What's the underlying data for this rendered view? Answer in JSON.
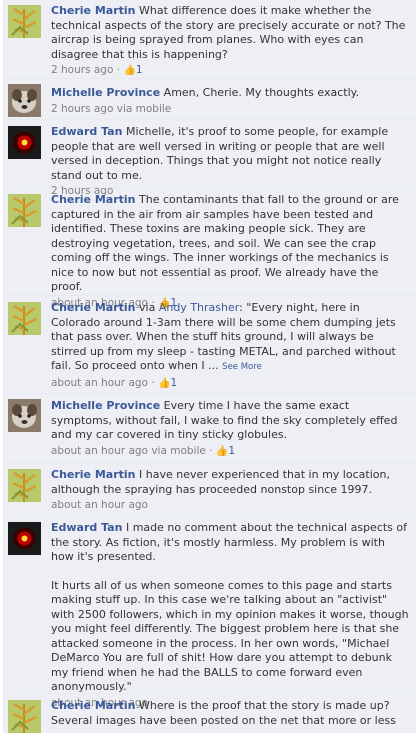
{
  "comments": [
    {
      "author": "Cherie Martin",
      "text": "What difference does it make whether the technical aspects of the story are precisely accurate or not? The aircrap is being sprayed from planes. Who with eyes can disagree that this is happening?",
      "time": "2 hours ago",
      "likes": "1"
    },
    {
      "author": "Michelle Province",
      "text": "Amen, Cherie. My thoughts exactly.",
      "time": "2 hours ago",
      "via": "via mobile"
    },
    {
      "author": "Edward Tan",
      "text": "Michelle, it's proof to some people, for example people that are well versed in writing or people that are well versed in deception. Things that you might not notice really stand out to me.",
      "time": "2 hours ago"
    },
    {
      "author": "Cherie Martin",
      "text": "The contaminants that fall to the ground or are captured in the air from air samples have been tested and identified. These toxins are making people sick. They are destroying vegetation, trees, and soil. We can see the crap coming off the wings. The inner workings of the mechanics is nice to now but not essential as proof. We already have the proof.",
      "time": "about an hour ago",
      "likes": "1"
    },
    {
      "author": "Cherie Martin",
      "via_prefix": "via",
      "via_name": "Andy Thrasher",
      "text": ": \"Every night, here in Colorado around 1-3am there will be some chem dumping jets that pass over. When the stuff hits ground, I will always be stirred up from my sleep - tasting METAL, and parched without fail. So proceed onto when I ...",
      "see_more": "See More",
      "time": "about an hour ago",
      "likes": "1"
    },
    {
      "author": "Michelle Province",
      "text": "Every time I have the same exact symptoms, without fail, I wake to find the sky completely effed and my car covered in tiny sticky globules.",
      "time": "about an hour ago",
      "via": "via mobile",
      "likes": "1"
    },
    {
      "author": "Cherie Martin",
      "text": "I have never experienced that in my location, although the spraying has proceeded nonstop since 1997.",
      "time": "about an hour ago"
    },
    {
      "author": "Edward Tan",
      "text": "I made no comment about the technical aspects of the story. As fiction, it's mostly harmless. My problem is with how it's presented.",
      "text2": "It hurts all of us when someone comes to this page and starts making stuff up. In this case we're talking about an \"activist\" with 2500 followers, which in my opinion makes it worse, though you might feel differently. The biggest problem here is that she attacked someone in the process. In her own words, \"Michael DeMarco You are full of shit! How dare you attempt to debunk my friend when he had the BALLS to come forward even anonymously.\"",
      "time": "about an hour ago"
    },
    {
      "author": "Cherie Martin",
      "text": "Where is the proof that the story is made up? Several images have been posted on the net that more or less"
    }
  ],
  "separator": "·",
  "colors": {
    "link": "#3b5998",
    "meta": "#808080",
    "background": "#edeff4"
  },
  "icons": {
    "like": "thumbs-up-icon"
  }
}
